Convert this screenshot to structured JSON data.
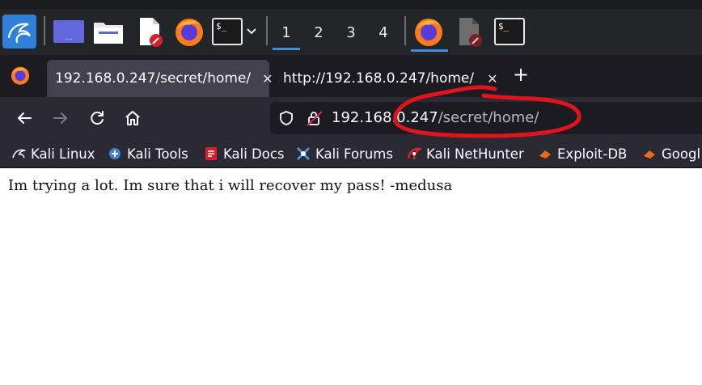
{
  "taskbar": {
    "workspaces": [
      "1",
      "2",
      "3",
      "4"
    ],
    "active_workspace": "1"
  },
  "browser": {
    "tabs": [
      {
        "title": "192.168.0.247/secret/home/",
        "active": true
      },
      {
        "title": "http://192.168.0.247/home/",
        "active": false
      }
    ],
    "close_glyph": "✕",
    "new_tab_glyph": "+",
    "url": {
      "host": "192.168.0.247",
      "path": "/secret/home/"
    },
    "bookmarks": [
      {
        "label": "Kali Linux",
        "icon": "kali-dragon-icon"
      },
      {
        "label": "Kali Tools",
        "icon": "kali-tools-icon"
      },
      {
        "label": "Kali Docs",
        "icon": "kali-docs-icon"
      },
      {
        "label": "Kali Forums",
        "icon": "kali-forums-icon"
      },
      {
        "label": "Kali NetHunter",
        "icon": "nethunter-icon"
      },
      {
        "label": "Exploit-DB",
        "icon": "exploit-db-icon"
      },
      {
        "label": "Googl",
        "icon": "google-hacking-icon"
      }
    ]
  },
  "page": {
    "text": "Im trying a lot. Im sure that i will recover my pass! -medusa"
  },
  "colors": {
    "panel": "#232629",
    "tabstrip": "#1c1b22",
    "toolbar": "#2b2a33",
    "accent": "#3b8fe0",
    "annotation": "#e0141c"
  }
}
